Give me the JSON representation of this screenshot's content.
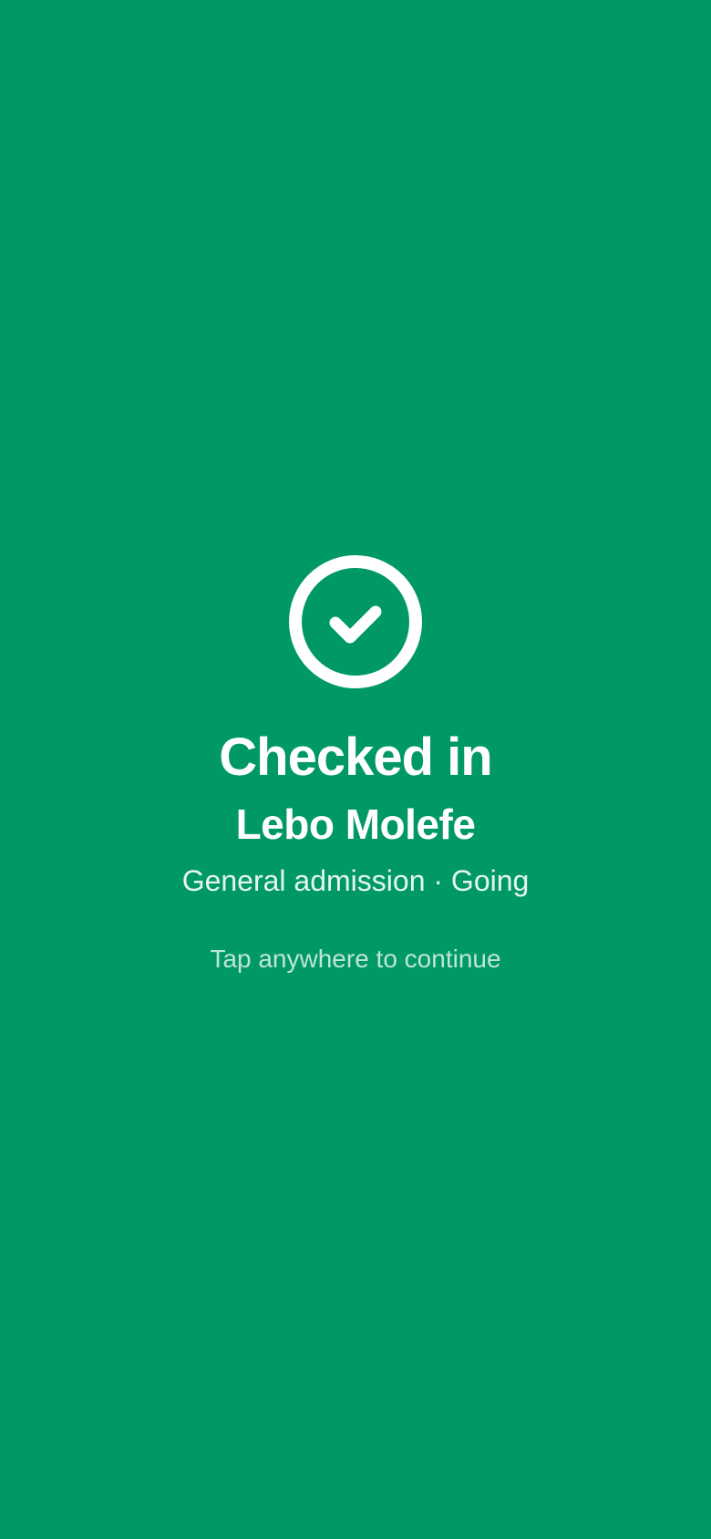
{
  "screen": {
    "background_color": "#009966",
    "icon": "check-circle-icon"
  },
  "status": {
    "title": "Checked in"
  },
  "attendee": {
    "name": "Lebo Molefe",
    "details": "General admission · Going"
  },
  "hint": {
    "text": "Tap anywhere to continue"
  }
}
